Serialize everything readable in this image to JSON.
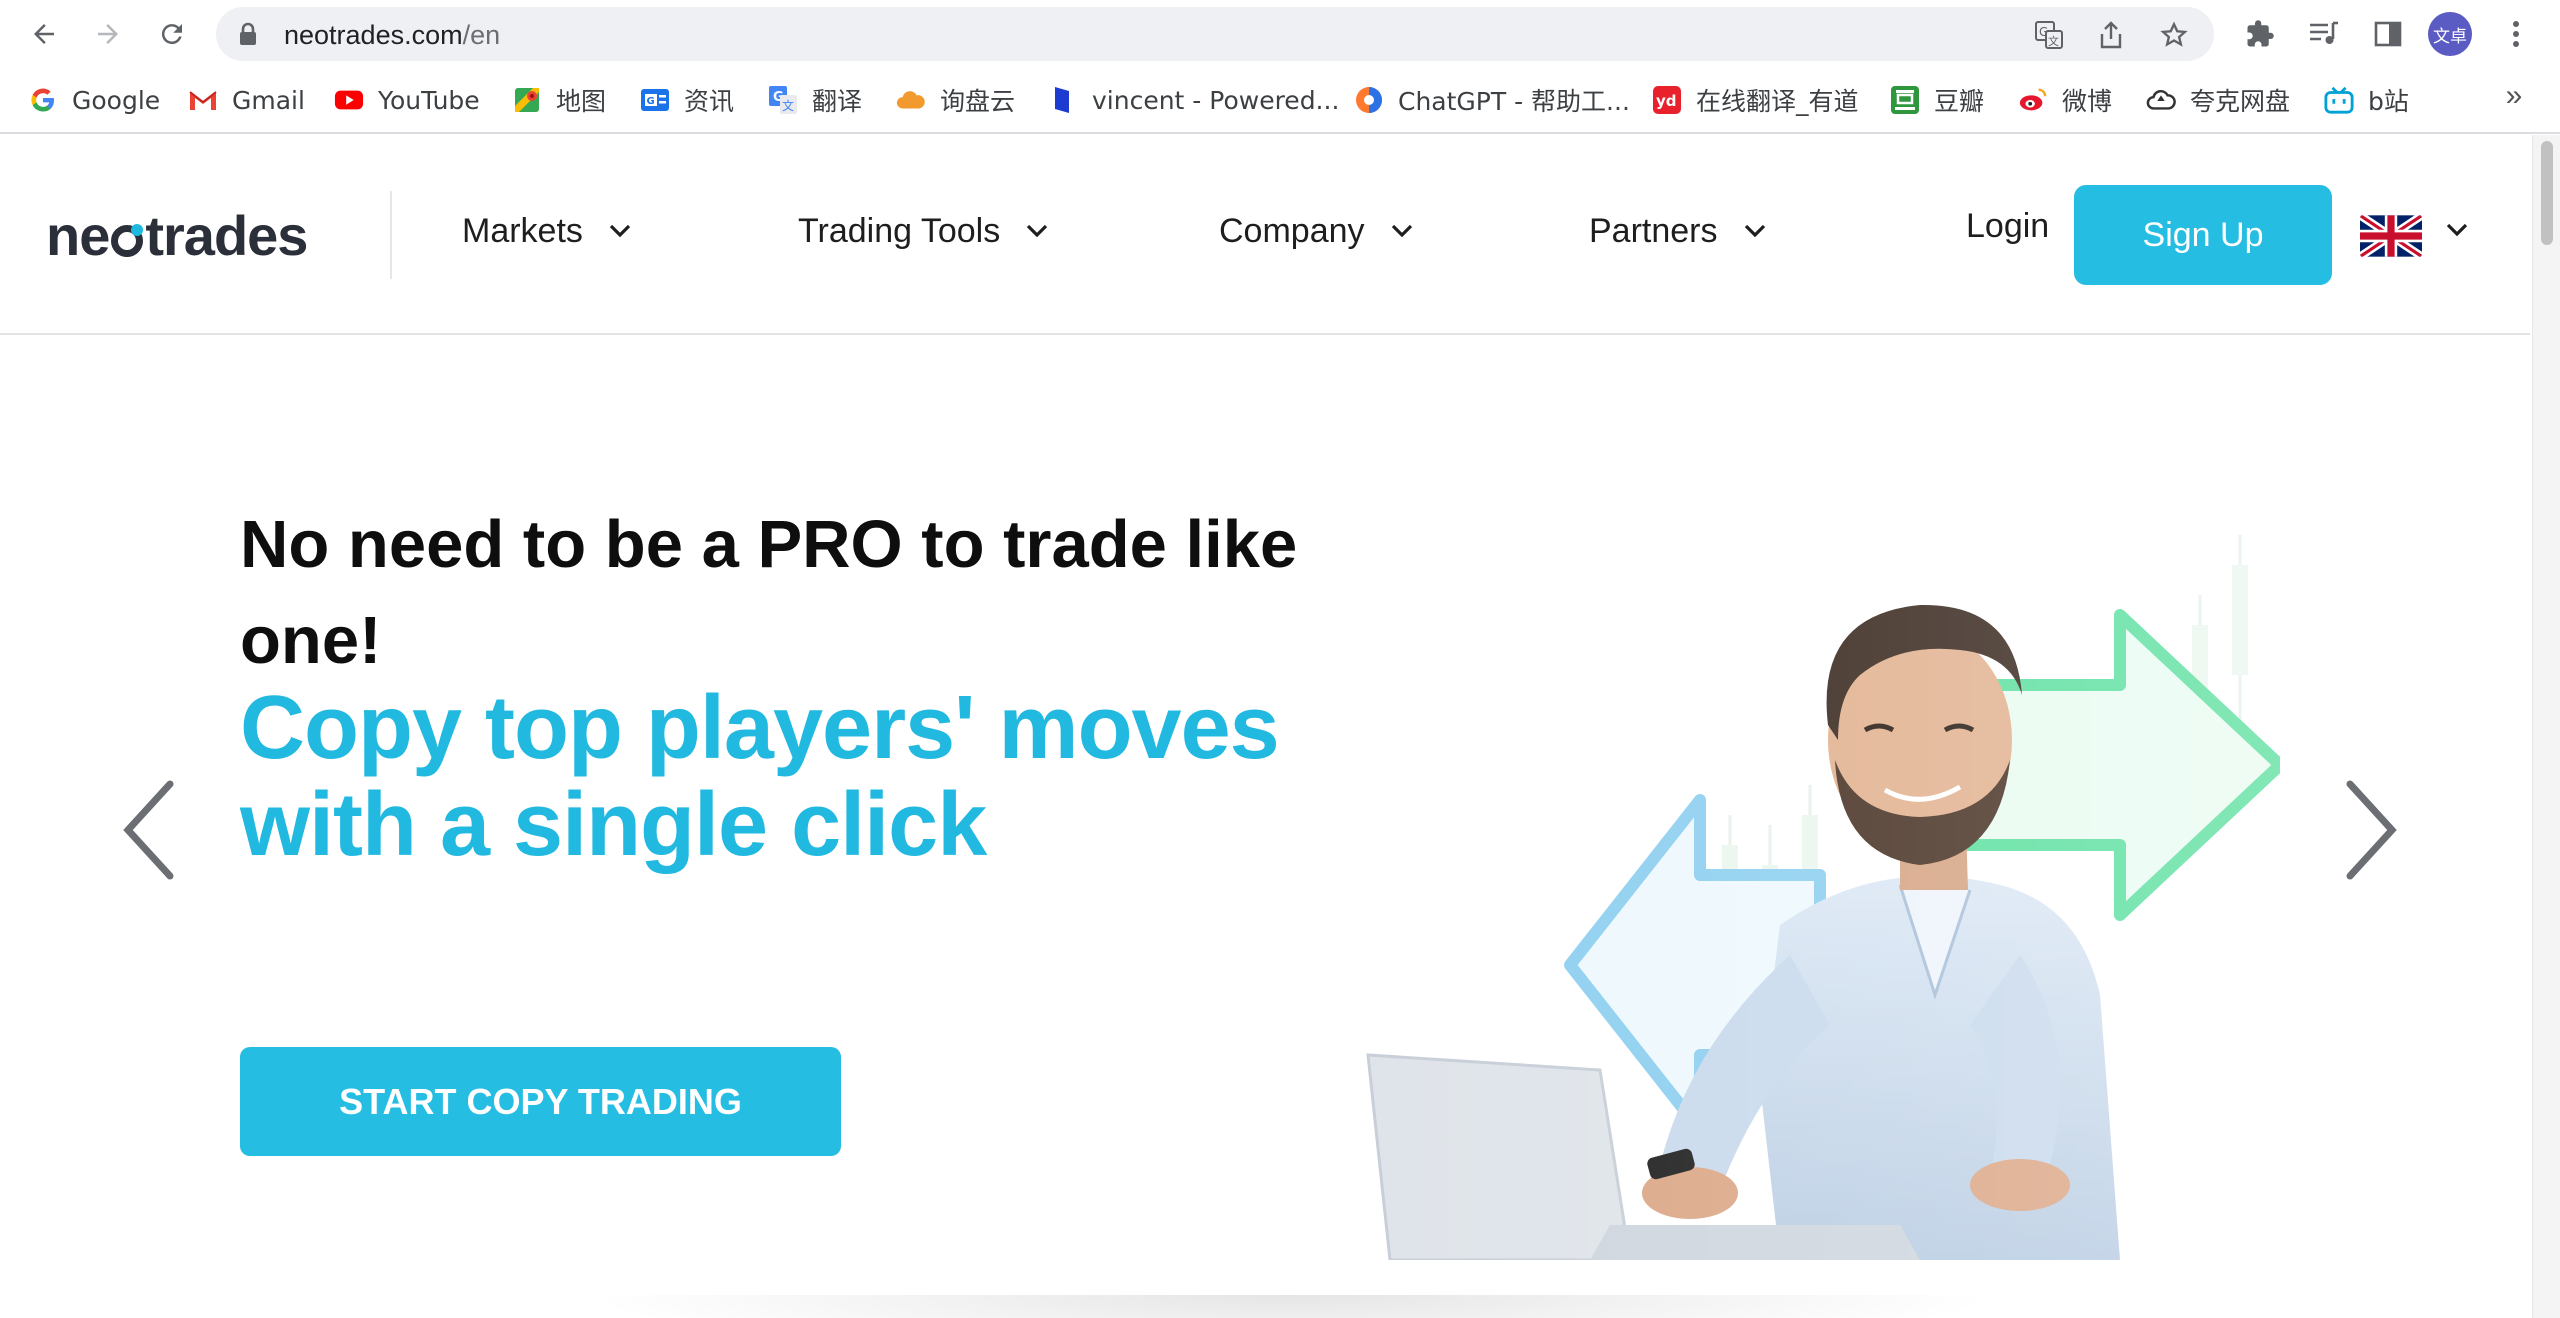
{
  "browser": {
    "url_host": "neotrades.com",
    "url_path": "/en",
    "profile_initials": "文卓"
  },
  "bookmarks": [
    {
      "label": "Google",
      "icon": "google-icon"
    },
    {
      "label": "Gmail",
      "icon": "gmail-icon"
    },
    {
      "label": "YouTube",
      "icon": "youtube-icon"
    },
    {
      "label": "地图",
      "icon": "maps-icon"
    },
    {
      "label": "资讯",
      "icon": "news-icon"
    },
    {
      "label": "翻译",
      "icon": "translate-icon"
    },
    {
      "label": "询盘云",
      "icon": "cloud-icon"
    },
    {
      "label": "vincent - Powered...",
      "icon": "document-icon"
    },
    {
      "label": "ChatGPT - 帮助工...",
      "icon": "chatgpt-icon"
    },
    {
      "label": "在线翻译_有道",
      "icon": "youdao-icon"
    },
    {
      "label": "豆瓣",
      "icon": "douban-icon"
    },
    {
      "label": "微博",
      "icon": "weibo-icon"
    },
    {
      "label": "夸克网盘",
      "icon": "quark-cloud-icon"
    },
    {
      "label": "b站",
      "icon": "bilibili-icon"
    }
  ],
  "site": {
    "logo_parts": [
      "ne",
      "trades"
    ],
    "nav": [
      {
        "label": "Markets"
      },
      {
        "label": "Trading Tools"
      },
      {
        "label": "Company"
      },
      {
        "label": "Partners"
      }
    ],
    "login_label": "Login",
    "signup_label": "Sign Up",
    "language": "English (UK)"
  },
  "hero": {
    "title": "No need to be a PRO to trade like one!",
    "subtitle": "Copy top players' moves with a single click",
    "cta_label": "START COPY TRADING"
  },
  "colors": {
    "brand_blue": "#26bde2",
    "logo_dark": "#2b2f3a",
    "arrow_green": "#5ee0a0",
    "arrow_blue": "#8fd0f0"
  }
}
